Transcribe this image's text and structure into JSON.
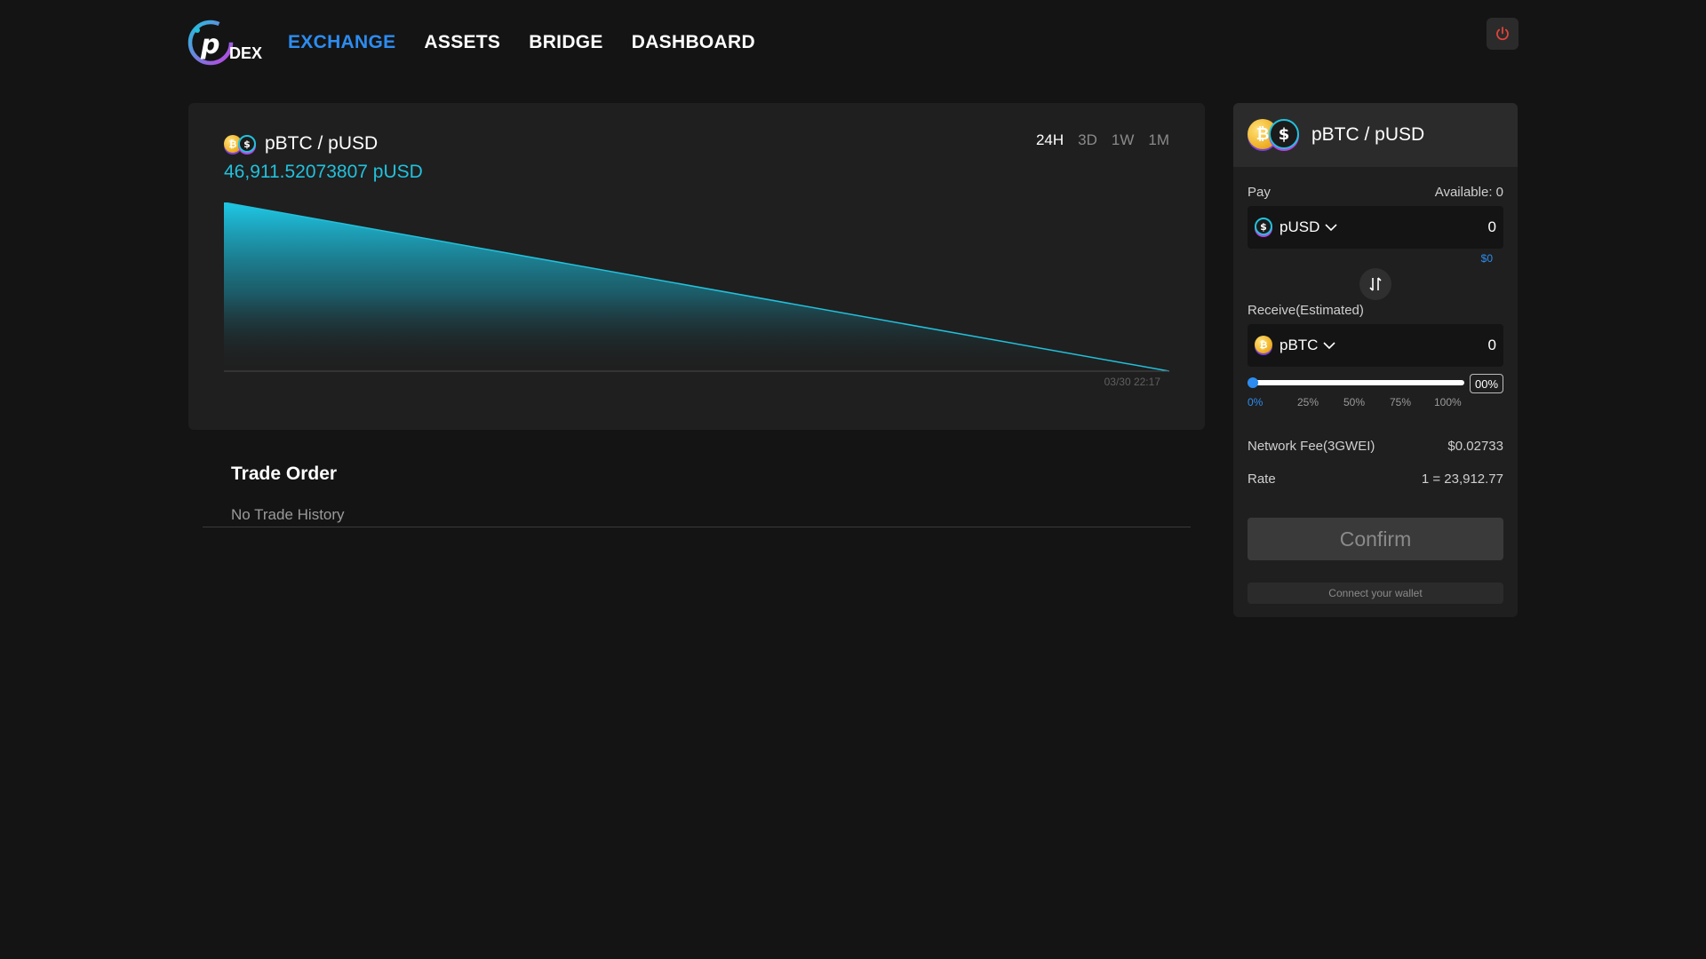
{
  "header": {
    "logo_text": "DEX",
    "nav": [
      {
        "label": "EXCHANGE",
        "active": true
      },
      {
        "label": "ASSETS",
        "active": false
      },
      {
        "label": "BRIDGE",
        "active": false
      },
      {
        "label": "DASHBOARD",
        "active": false
      }
    ],
    "power_icon": "power-icon"
  },
  "chart_panel": {
    "pair": "pBTC / pUSD",
    "price": "46,911.52073807 pUSD",
    "ranges": [
      {
        "label": "24H",
        "active": true
      },
      {
        "label": "3D",
        "active": false
      },
      {
        "label": "1W",
        "active": false
      },
      {
        "label": "1M",
        "active": false
      }
    ]
  },
  "chart_data": {
    "type": "area",
    "x": [
      "",
      "03/30 22:17"
    ],
    "values": [
      46911.52073807,
      0
    ],
    "tick_labels": [
      "03/30 22:17"
    ],
    "fill_color": "#22c1dc",
    "grid": false
  },
  "trade_order": {
    "title": "Trade Order",
    "empty_text": "No Trade History"
  },
  "swap": {
    "pair": "pBTC / pUSD",
    "pay_label": "Pay",
    "available": "Available: 0",
    "pay_token": "pUSD",
    "pay_amount": "0",
    "pay_usd": "$0",
    "receive_label": "Receive(Estimated)",
    "receive_token": "pBTC",
    "receive_amount": "0",
    "slider_percent": "00%",
    "slider_fraction": 0,
    "slider_marks": [
      "0%",
      "25%",
      "50%",
      "75%",
      "100%"
    ],
    "fee_label": "Network Fee(3GWEI)",
    "fee_value": "$0.02733",
    "rate_label": "Rate",
    "rate_value": "1 = 23,912.77",
    "confirm_label": "Confirm",
    "wallet_label": "Connect your wallet"
  },
  "colors": {
    "accent": "#2d8cf0",
    "price": "#22c1dc",
    "background": "#141414",
    "panel": "#1f1f1f",
    "power": "#e0443a"
  }
}
